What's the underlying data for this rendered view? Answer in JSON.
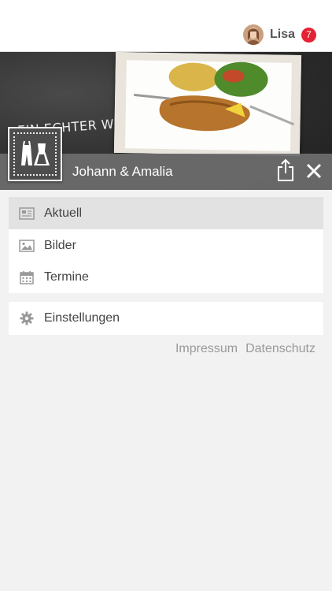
{
  "header": {
    "username": "Lisa",
    "notification_count": "7"
  },
  "hero": {
    "slogan": "EIN ECHTER WIENER!",
    "page_name": "Johann & Amalia"
  },
  "menu": {
    "items": [
      {
        "label": "Aktuell",
        "icon": "newspaper-icon",
        "active": true
      },
      {
        "label": "Bilder",
        "icon": "image-icon",
        "active": false
      },
      {
        "label": "Termine",
        "icon": "calendar-icon",
        "active": false
      }
    ],
    "settings": {
      "label": "Einstellungen",
      "icon": "gear-icon"
    }
  },
  "footer": {
    "impressum": "Impressum",
    "datenschutz": "Datenschutz"
  },
  "colors": {
    "badge": "#e52234",
    "active_item": "#e2e2e2",
    "titlebar": "#6e6e6e"
  }
}
